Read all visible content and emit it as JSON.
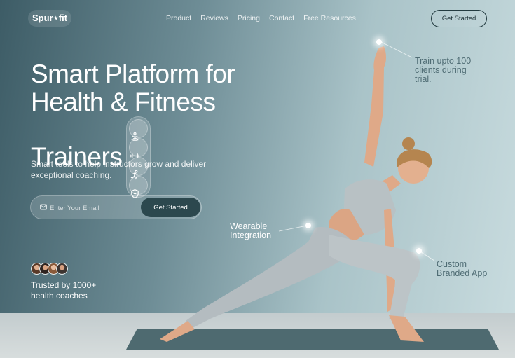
{
  "nav": {
    "logo": "Spur⋆fit",
    "links": [
      "Product",
      "Reviews",
      "Pricing",
      "Contact",
      "Free Resources"
    ],
    "cta": "Get Started"
  },
  "hero": {
    "title_line1": "Smart Platform for",
    "title_line2": "Health & Fitness",
    "title_line3": "Trainers",
    "feature_icons": [
      "yoga-icon",
      "dumbbell-icon",
      "running-icon",
      "shield-plus-icon"
    ],
    "subtitle": "Smart tools to help instructors grow and deliver exceptional coaching.",
    "email_placeholder": "Enter Your Email",
    "email_cta": "Get Started"
  },
  "social_proof": {
    "text": "Trusted by 1000+ health coaches"
  },
  "callouts": {
    "trial": "Train upto 100 clients during trial.",
    "wearable": "Wearable Integration",
    "branded": "Custom Branded App"
  },
  "colors": {
    "accent_dark": "#2c484e",
    "text_muted": "#4f6c74"
  }
}
